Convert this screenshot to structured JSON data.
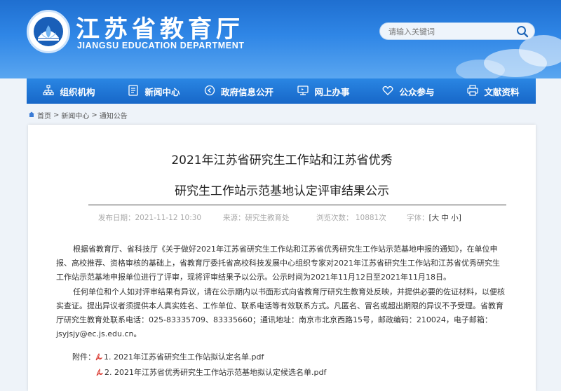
{
  "header": {
    "title_cn": "江苏省教育厅",
    "title_en": "JIANGSU EDUCATION DEPARTMENT",
    "search_placeholder": "请输入关键词"
  },
  "nav": {
    "items": [
      {
        "label": "组织机构",
        "icon": "org-chart-icon"
      },
      {
        "label": "新闻中心",
        "icon": "news-doc-icon"
      },
      {
        "label": "政府信息公开",
        "icon": "info-open-icon"
      },
      {
        "label": "网上办事",
        "icon": "monitor-icon"
      },
      {
        "label": "公众参与",
        "icon": "heart-icon"
      },
      {
        "label": "文献资料",
        "icon": "printer-icon"
      }
    ]
  },
  "breadcrumb": {
    "home": "首页",
    "sep1": ">",
    "news": "新闻中心",
    "sep2": ">",
    "notice": "通知公告"
  },
  "article": {
    "title_line1": "2021年江苏省研究生工作站和江苏省优秀",
    "title_line2": "研究生工作站示范基地认定评审结果公示",
    "meta": {
      "date": "发布日期：2021-11-12 10:30",
      "source": "来源：研究生教育处",
      "views": "浏览次数：  10881次",
      "font_label": "字体：",
      "font_ctl": "[大 中 小]"
    },
    "paragraph1": "根据省教育厅、省科技厅《关于做好2021年江苏省研究生工作站和江苏省优秀研究生工作站示范基地申报的通知》，在单位申报、高校推荐、资格审核的基础上，省教育厅委托省高校科技发展中心组织专家对2021年江苏省研究生工作站和江苏省优秀研究生工作站示范基地申报单位进行了评审，现将评审结果予以公示。公示时间为2021年11月12日至2021年11月18日。",
    "paragraph2": "任何单位和个人如对评审结果有异议，请在公示期内以书面形式向省教育厅研究生教育处反映，并提供必要的佐证材料，以便核实查证。提出异议者须提供本人真实姓名、工作单位、联系电话等有效联系方式。凡匿名、冒名或超出期限的异议不予受理。省教育厅研究生教育处联系电话：025-83335709、83335660；通讯地址：南京市北京西路15号，邮政编码：210024，电子邮箱：jsyjsjy@ec.js.edu.cn。",
    "attach_label": "附件：",
    "attachments": [
      "1. 2021年江苏省研究生工作站拟认定名单.pdf",
      "2. 2021年江苏省优秀研究生工作站示范基地拟认定候选名单.pdf"
    ]
  },
  "colors": {
    "banner": "#2f86e6",
    "nav": "#1767c8",
    "pdf": "#d9382f"
  }
}
